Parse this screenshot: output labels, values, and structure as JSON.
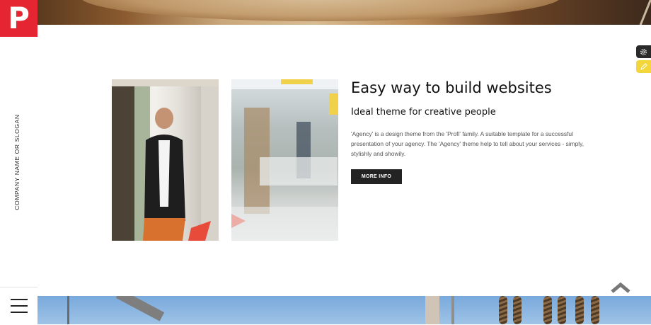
{
  "logo": {
    "letter": "P"
  },
  "sidebar": {
    "slogan": "COMPANY NAME OR SLOGAN"
  },
  "content": {
    "title": "Easy way to build websites",
    "subtitle": "Ideal theme for creative people",
    "description": "'Agency' is a design theme from the 'Profi' family. A suitable template for a successful presentation of your agency. The 'Agency' theme help to tell about your services - simply, stylishly and showily.",
    "button_label": "MORE INFO"
  },
  "icons": {
    "menu": "hamburger-menu-icon",
    "settings": "gear-icon",
    "edit": "pencil-icon",
    "scroll": "chevron-up-icon"
  },
  "colors": {
    "brand": "#e52632",
    "button": "#232323",
    "edit_widget": "#f2d63b"
  }
}
